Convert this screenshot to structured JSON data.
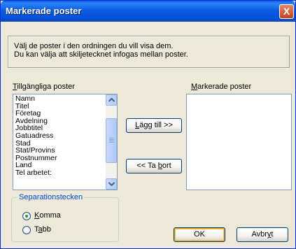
{
  "window": {
    "title": "Markerade poster",
    "close_glyph": "X"
  },
  "info": {
    "line1": "Välj de poster i den ordningen du vill visa dem.",
    "line2": "Du kan välja att skiljetecknet infogas mellan poster."
  },
  "available": {
    "label_accel": "T",
    "label_rest": "illgängliga poster",
    "items": [
      "Namn",
      "Titel",
      "Företag",
      "Avdelning",
      "Jobbtitel",
      "Gatuadress",
      "Stad",
      "Stat/Provins",
      "Postnummer",
      "Land",
      "Tel arbetet:"
    ]
  },
  "selected": {
    "label_accel": "M",
    "label_rest": "arkerade poster",
    "items": []
  },
  "buttons": {
    "add_accel": "L",
    "add_rest": "ägg till >>",
    "remove_pre": "<< Ta ",
    "remove_accel": "b",
    "remove_rest": "ort",
    "ok_label": "OK",
    "cancel_pre": "Avbr",
    "cancel_accel": "y",
    "cancel_rest": "t"
  },
  "separator": {
    "title": "Separationstecken",
    "options": [
      {
        "accel": "K",
        "rest": "omma",
        "selected": true
      },
      {
        "pre": "T",
        "accel": "a",
        "rest": "bb",
        "selected": false
      }
    ]
  },
  "colors": {
    "titlebar": "#0450d4",
    "window_bg": "#ece9d8",
    "group_title": "#0046d5",
    "radio_dot": "#21a121"
  }
}
